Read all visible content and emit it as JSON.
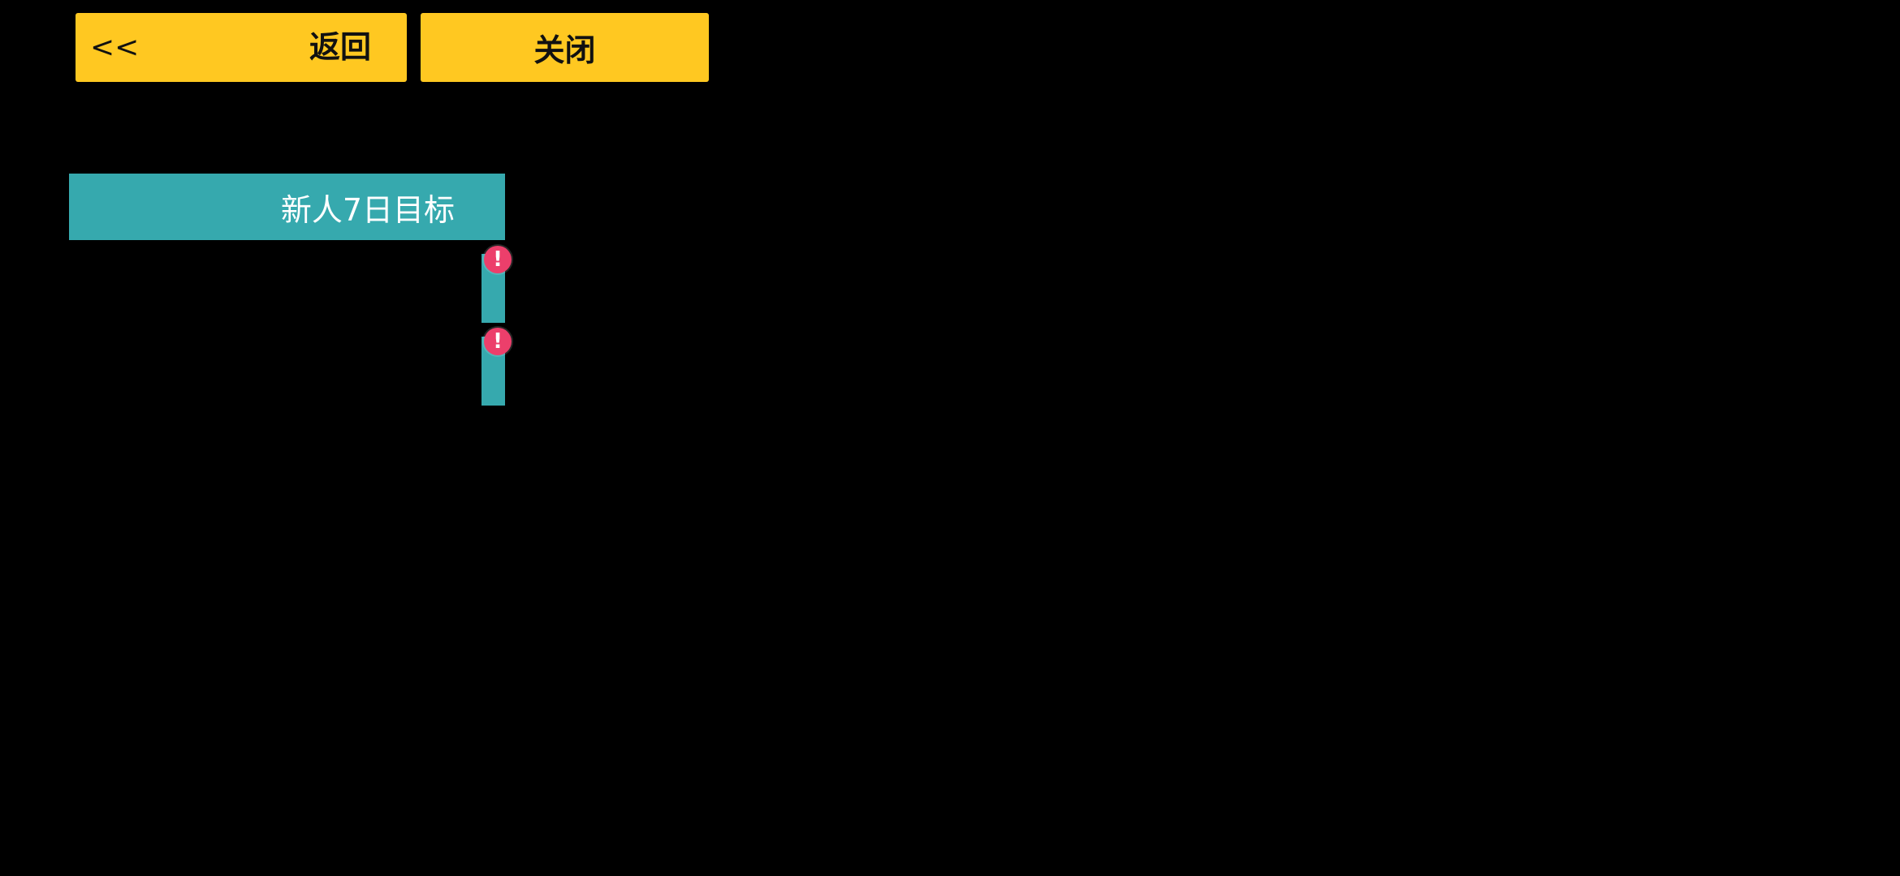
{
  "colors": {
    "background": "#000000",
    "button_yellow": "#FFC821",
    "teal": "#36A9AE",
    "badge_pink": "#EC3F6B"
  },
  "header": {
    "back_chevron": "<<",
    "back_label": "返回",
    "close_label": "关闭"
  },
  "tabs": {
    "main_label": "新人7日目标",
    "side_tabs": [
      {
        "badge": "!",
        "badge_icon": "exclamation-icon"
      },
      {
        "badge": "!",
        "badge_icon": "exclamation-icon"
      }
    ]
  }
}
